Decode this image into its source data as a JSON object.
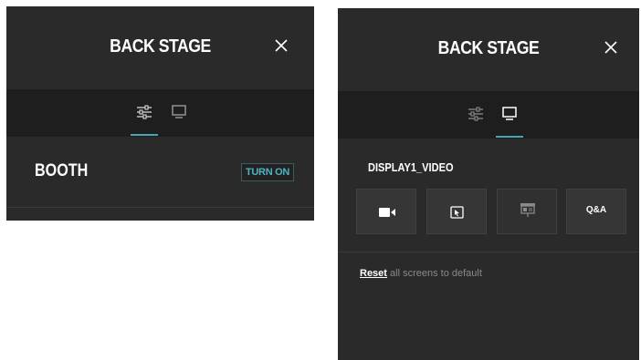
{
  "left_panel": {
    "title": "BACK STAGE",
    "tabs": [
      {
        "icon": "sliders-icon",
        "active": true
      },
      {
        "icon": "monitor-icon",
        "active": false
      }
    ],
    "booth": {
      "label": "BOOTH",
      "button_label": "TURN ON"
    }
  },
  "right_panel": {
    "title": "BACK STAGE",
    "tabs": [
      {
        "icon": "sliders-icon",
        "active": false
      },
      {
        "icon": "monitor-icon",
        "active": true
      }
    ],
    "display_name": "DISPLAY1_VIDEO",
    "tiles": [
      {
        "icon": "video-camera-icon"
      },
      {
        "icon": "screen-share-icon"
      },
      {
        "icon": "presentation-icon"
      },
      {
        "label": "Q&A"
      }
    ],
    "reset": {
      "link_label": "Reset",
      "text": " all screens to default"
    }
  },
  "colors": {
    "panel_bg": "#2a2a2b",
    "tabbar_bg": "#1e1e1f",
    "accent": "#46a5b5",
    "muted_text": "#8a8a8a"
  }
}
